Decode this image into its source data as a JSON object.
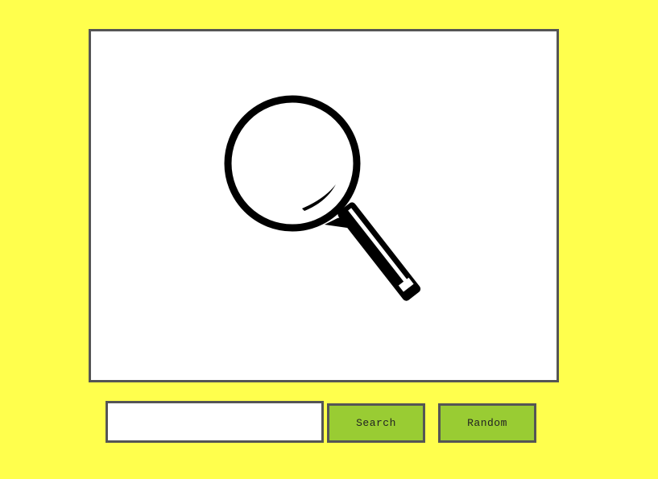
{
  "main_image": {
    "icon": "magnifying-glass-icon"
  },
  "search": {
    "value": "",
    "placeholder": "",
    "button_label": "Search"
  },
  "random": {
    "button_label": "Random"
  },
  "colors": {
    "background": "#ffff4d",
    "button": "#99cc33",
    "border": "#555555",
    "panel": "#ffffff"
  }
}
